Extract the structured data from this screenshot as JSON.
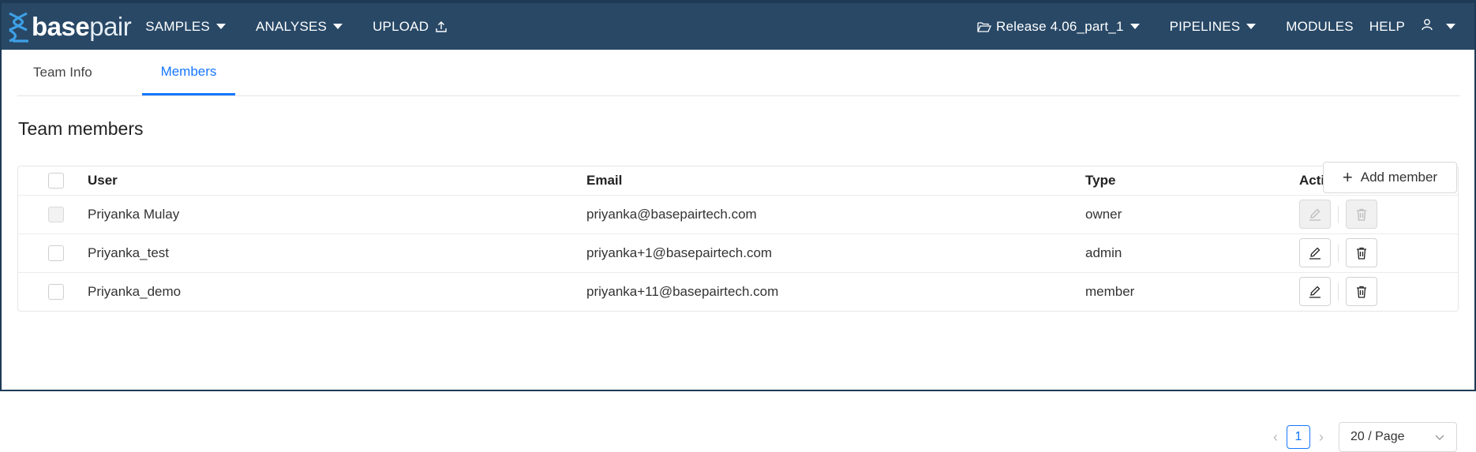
{
  "nav": {
    "logo_bold": "base",
    "logo_light": "pair",
    "samples": "SAMPLES",
    "analyses": "ANALYSES",
    "upload": "UPLOAD",
    "project": "Release 4.06_part_1",
    "pipelines": "PIPELINES",
    "modules": "MODULES",
    "help": "HELP"
  },
  "tabs": [
    {
      "label": "Team Info",
      "active": false
    },
    {
      "label": "Members",
      "active": true
    }
  ],
  "page_title": "Team members",
  "add_member_label": "Add member",
  "table": {
    "headers": {
      "user": "User",
      "email": "Email",
      "type": "Type",
      "action": "Action"
    },
    "rows": [
      {
        "user": "Priyanka Mulay",
        "email": "priyanka@basepairtech.com",
        "type": "owner",
        "disabled": true
      },
      {
        "user": "Priyanka_test",
        "email": "priyanka+1@basepairtech.com",
        "type": "admin",
        "disabled": false
      },
      {
        "user": "Priyanka_demo",
        "email": "priyanka+11@basepairtech.com",
        "type": "member",
        "disabled": false
      }
    ]
  },
  "pagination": {
    "current_page": "1",
    "page_size": "20 / Page"
  },
  "colors": {
    "navbar": "#284866",
    "accent": "#1677ff"
  }
}
